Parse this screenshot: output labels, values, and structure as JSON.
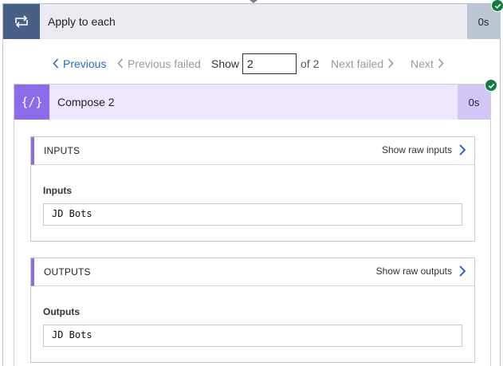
{
  "apply_to_each": {
    "title": "Apply to each",
    "duration": "0s",
    "icon": "loop-icon",
    "color": "#485f86",
    "status": "succeeded"
  },
  "pager": {
    "previous": "Previous",
    "previous_failed": "Previous failed",
    "show_label": "Show",
    "current_page": "2",
    "of_label": "of 2",
    "next_failed": "Next failed",
    "next": "Next"
  },
  "compose": {
    "title": "Compose 2",
    "duration": "0s",
    "icon": "{/}",
    "color": "#8c6ce8",
    "status": "succeeded",
    "inputs": {
      "section_title": "INPUTS",
      "raw_link": "Show raw inputs",
      "field_label": "Inputs",
      "value": "JD Bots"
    },
    "outputs": {
      "section_title": "OUTPUTS",
      "raw_link": "Show raw outputs",
      "field_label": "Outputs",
      "value": "JD Bots"
    }
  }
}
